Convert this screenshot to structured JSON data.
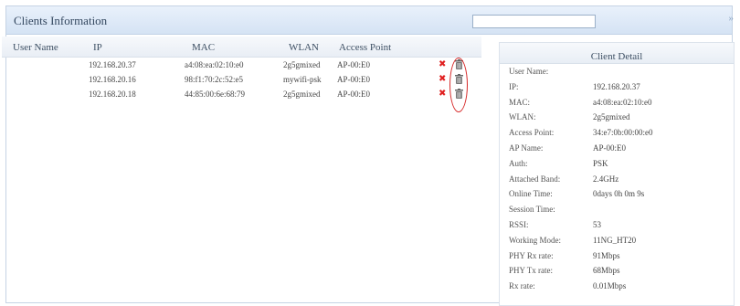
{
  "header": {
    "title": "Clients Information",
    "search_value": "",
    "collapse_glyph": "»"
  },
  "table": {
    "columns": [
      "User Name",
      "IP",
      "MAC",
      "WLAN",
      "Access Point"
    ],
    "rows": [
      {
        "user": "",
        "ip": "192.168.20.37",
        "mac": "a4:08:ea:02:10:e0",
        "wlan": "2g5gmixed",
        "ap": "AP-00:E0"
      },
      {
        "user": "",
        "ip": "192.168.20.16",
        "mac": "98:f1:70:2c:52:e5",
        "wlan": "mywifi-psk",
        "ap": "AP-00:E0"
      },
      {
        "user": "",
        "ip": "192.168.20.18",
        "mac": "44:85:00:6e:68:79",
        "wlan": "2g5gmixed",
        "ap": "AP-00:E0"
      }
    ],
    "delete_glyph": "✖"
  },
  "detail": {
    "title": "Client Detail",
    "fields": [
      {
        "label": "User Name:",
        "value": ""
      },
      {
        "label": "IP:",
        "value": "192.168.20.37"
      },
      {
        "label": "MAC:",
        "value": "a4:08:ea:02:10:e0"
      },
      {
        "label": "WLAN:",
        "value": "2g5gmixed"
      },
      {
        "label": "Access Point:",
        "value": "34:e7:0b:00:00:e0"
      },
      {
        "label": "AP Name:",
        "value": "AP-00:E0"
      },
      {
        "label": "Auth:",
        "value": "PSK"
      },
      {
        "label": "Attached Band:",
        "value": "2.4GHz"
      },
      {
        "label": "Online Time:",
        "value": "0days 0h 0m 9s"
      },
      {
        "label": "Session Time:",
        "value": ""
      },
      {
        "label": "RSSI:",
        "value": "53"
      },
      {
        "label": "Working Mode:",
        "value": "11NG_HT20"
      },
      {
        "label": "PHY Rx rate:",
        "value": "91Mbps"
      },
      {
        "label": "PHY Tx rate:",
        "value": "68Mbps"
      },
      {
        "label": "Rx rate:",
        "value": "0.01Mbps"
      }
    ]
  },
  "colors": {
    "header_bg": "#dbe7f6",
    "delete_red": "#e02020",
    "highlight_red": "#d62828"
  }
}
